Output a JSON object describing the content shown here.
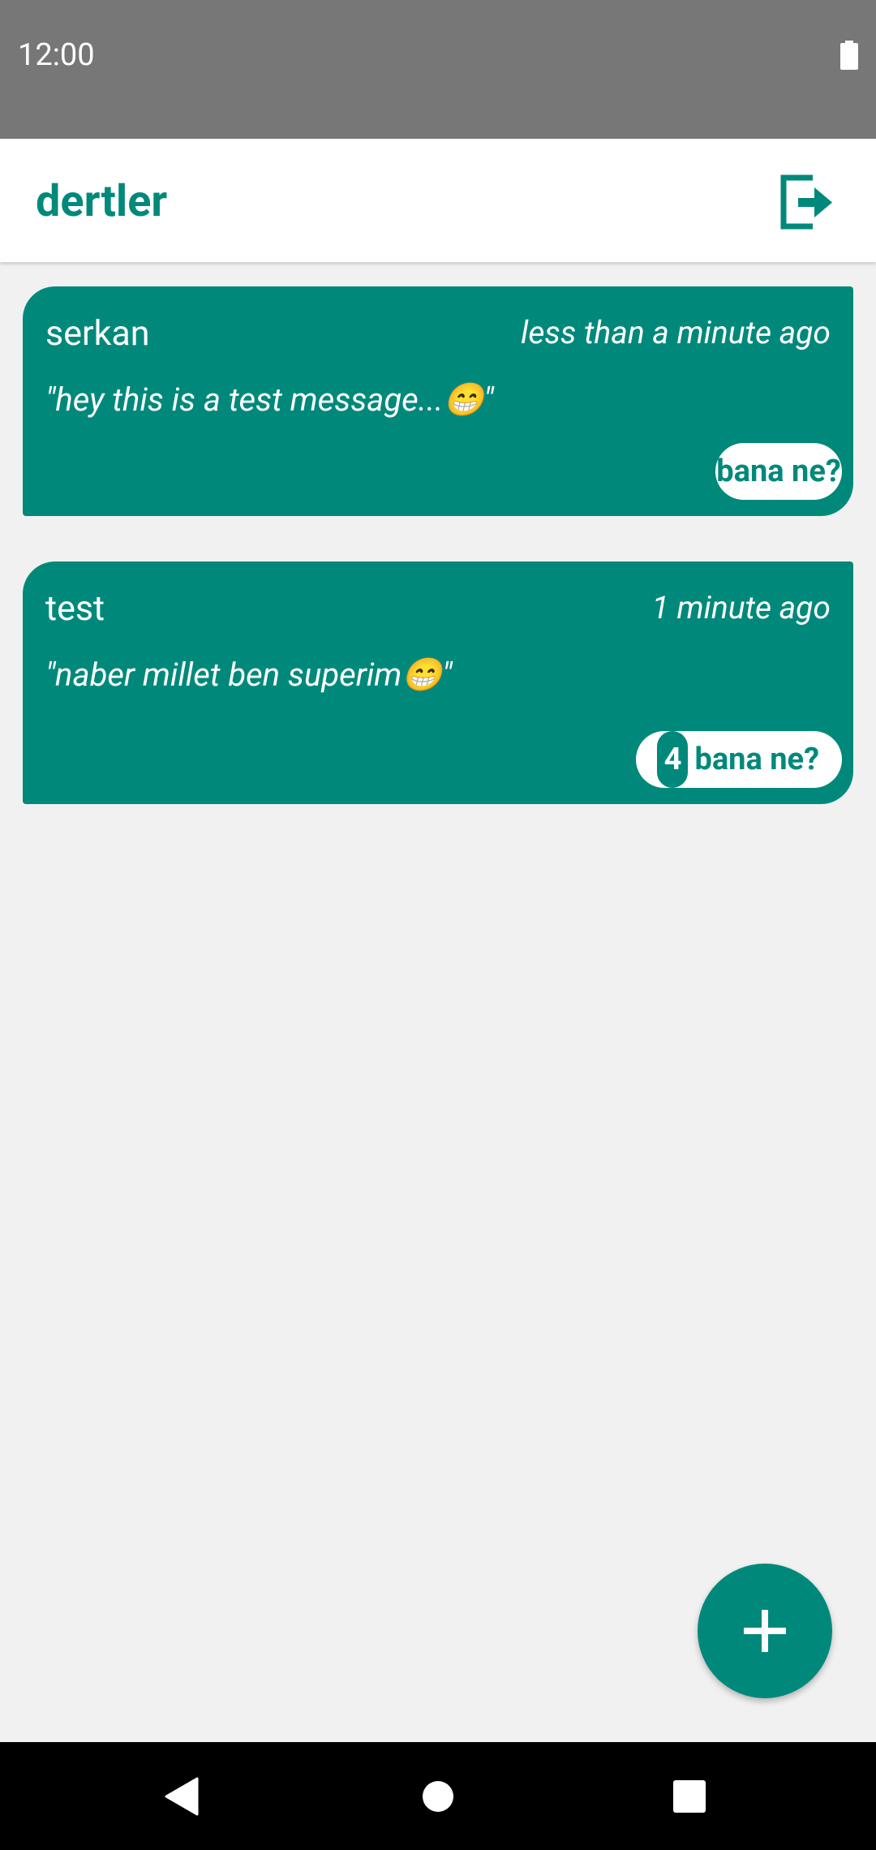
{
  "status_bar": {
    "time": "12:00",
    "battery_icon": "battery-full-icon"
  },
  "app_bar": {
    "title": "dertler",
    "logout_icon": "logout-icon"
  },
  "posts": [
    {
      "author": "serkan",
      "time": "less than a minute ago",
      "message": "\"hey this is a test message...😁\"",
      "reaction_label": "bana ne?",
      "reaction_count": ""
    },
    {
      "author": "test",
      "time": "1 minute ago",
      "message": "\"naber millet ben superim😁\"",
      "reaction_label": "bana ne?",
      "reaction_count": "4"
    }
  ],
  "fab": {
    "icon": "plus-icon"
  },
  "nav_bar": {
    "back_icon": "back-triangle-icon",
    "home_icon": "home-circle-icon",
    "recents_icon": "recents-square-icon"
  },
  "colors": {
    "accent": "#00897b",
    "status_bar": "#777777",
    "background": "#f1f1f1"
  }
}
